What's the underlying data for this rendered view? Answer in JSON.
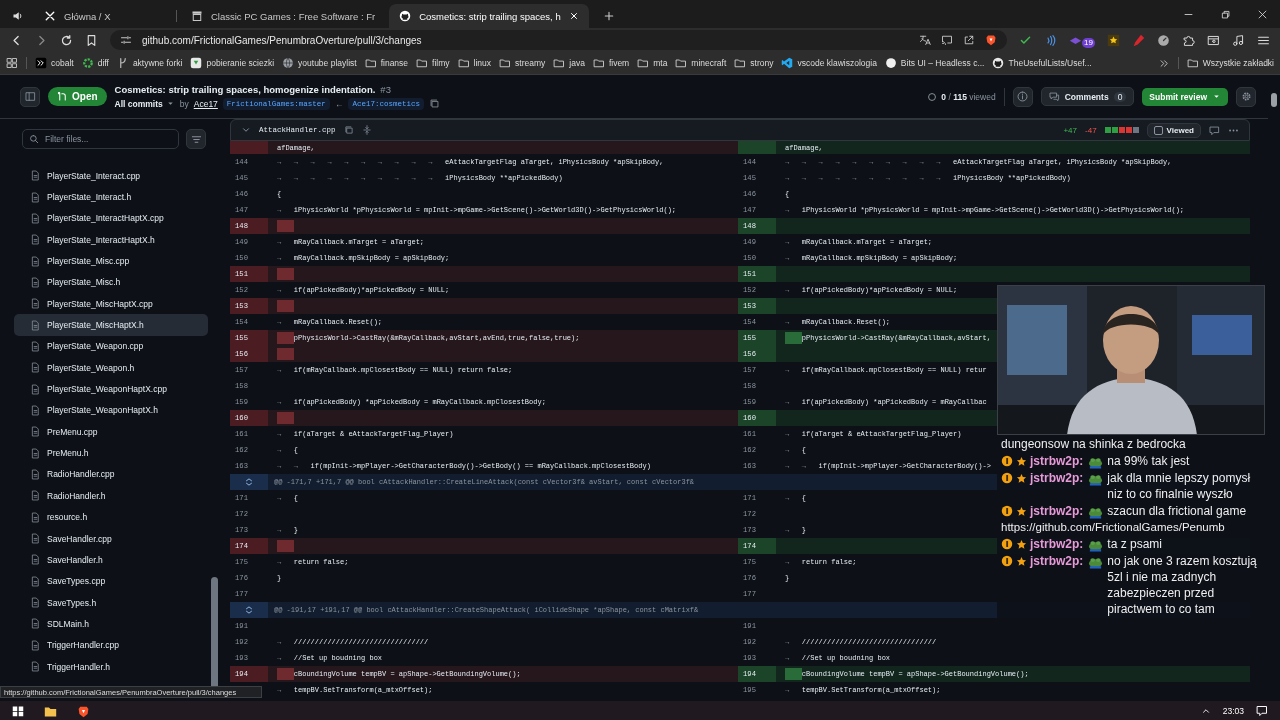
{
  "browser": {
    "tabs": [
      {
        "label": "Główna / X",
        "selected": false
      },
      {
        "label": "Classic PC Games : Free Software : Fr",
        "selected": false
      },
      {
        "label": "Cosmetics: strip trailing spaces, h",
        "selected": true
      }
    ],
    "url": "github.com/FrictionalGames/PenumbraOverture/pull/3/changes",
    "extension_badge": "19",
    "bookmarks": [
      {
        "label": "cobalt",
        "kind": "site"
      },
      {
        "label": "diff",
        "kind": "site"
      },
      {
        "label": "aktywne forki",
        "kind": "site"
      },
      {
        "label": "pobieranie sciezki",
        "kind": "site"
      },
      {
        "label": "youtube playlist",
        "kind": "site"
      },
      {
        "label": "finanse",
        "kind": "folder"
      },
      {
        "label": "filmy",
        "kind": "folder"
      },
      {
        "label": "linux",
        "kind": "folder"
      },
      {
        "label": "streamy",
        "kind": "folder"
      },
      {
        "label": "java",
        "kind": "folder"
      },
      {
        "label": "fivem",
        "kind": "folder"
      },
      {
        "label": "mta",
        "kind": "folder"
      },
      {
        "label": "minecraft",
        "kind": "folder"
      },
      {
        "label": "strony",
        "kind": "folder"
      },
      {
        "label": "vscode klawiszologia",
        "kind": "site"
      },
      {
        "label": "Bits UI – Headless c...",
        "kind": "site"
      },
      {
        "label": "TheUsefulLists/Usef...",
        "kind": "site"
      }
    ],
    "all_bookmarks": "Wszystkie zakładki",
    "status_url": "https://github.com/FrictionalGames/PenumbraOverture/pull/3/changes"
  },
  "pr": {
    "state": "Open",
    "title": "Cosmetics: strip trailing spaces, homogenize indentation.",
    "number": "#3",
    "commits_filter": "All commits",
    "by": "by",
    "author": "Ace17",
    "base": "FrictionalGames:master",
    "arrow": "←",
    "head": "Ace17:cosmetics",
    "viewed": "**0** / **115** viewed",
    "comments": "Comments",
    "comments_count": "0",
    "submit": "Submit review"
  },
  "sidebar": {
    "filter_placeholder": "Filter files...",
    "files": [
      {
        "name": "PlayerState_Interact.cpp",
        "highlighted": false
      },
      {
        "name": "PlayerState_Interact.h",
        "highlighted": false
      },
      {
        "name": "PlayerState_InteractHaptX.cpp",
        "highlighted": false
      },
      {
        "name": "PlayerState_InteractHaptX.h",
        "highlighted": false
      },
      {
        "name": "PlayerState_Misc.cpp",
        "highlighted": false
      },
      {
        "name": "PlayerState_Misc.h",
        "highlighted": false
      },
      {
        "name": "PlayerState_MiscHaptX.cpp",
        "highlighted": false
      },
      {
        "name": "PlayerState_MiscHaptX.h",
        "highlighted": true
      },
      {
        "name": "PlayerState_Weapon.cpp",
        "highlighted": false
      },
      {
        "name": "PlayerState_Weapon.h",
        "highlighted": false
      },
      {
        "name": "PlayerState_WeaponHaptX.cpp",
        "highlighted": false
      },
      {
        "name": "PlayerState_WeaponHaptX.h",
        "highlighted": false
      },
      {
        "name": "PreMenu.cpp",
        "highlighted": false
      },
      {
        "name": "PreMenu.h",
        "highlighted": false
      },
      {
        "name": "RadioHandler.cpp",
        "highlighted": false
      },
      {
        "name": "RadioHandler.h",
        "highlighted": false
      },
      {
        "name": "resource.h",
        "highlighted": false
      },
      {
        "name": "SaveHandler.cpp",
        "highlighted": false
      },
      {
        "name": "SaveHandler.h",
        "highlighted": false
      },
      {
        "name": "SaveTypes.cpp",
        "highlighted": false
      },
      {
        "name": "SaveTypes.h",
        "highlighted": false
      },
      {
        "name": "SDLMain.h",
        "highlighted": false
      },
      {
        "name": "TriggerHandler.cpp",
        "highlighted": false
      },
      {
        "name": "TriggerHandler.h",
        "highlighted": false
      }
    ]
  },
  "file": {
    "name": "AttackHandler.cpp",
    "additions": "+47",
    "deletions": "-47",
    "diffstat": [
      {
        "color": "#2ea043"
      },
      {
        "color": "#2ea043"
      },
      {
        "color": "#da3633"
      },
      {
        "color": "#da3633"
      },
      {
        "color": "#6e7681"
      }
    ],
    "viewed": false,
    "viewed_label": "Viewed",
    "rows": [
      {
        "kind": "cut",
        "left_code": "afDamage,",
        "right_code": "afDamage,"
      },
      {
        "kind": "context",
        "left_num": "144",
        "right_num": "144",
        "indent": "→→→→→→→→→→",
        "left_code": "eAttackTargetFlag aTarget, iPhysicsBody *apSkipBody,",
        "right_code": "eAttackTargetFlag aTarget, iPhysicsBody *apSkipBody,"
      },
      {
        "kind": "context",
        "left_num": "145",
        "right_num": "145",
        "indent": "→→→→→→→→→→",
        "left_code": "iPhysicsBody **apPickedBody)",
        "right_code": "iPhysicsBody **apPickedBody)"
      },
      {
        "kind": "context",
        "left_num": "146",
        "right_num": "146",
        "left_code": "{",
        "right_code": "{"
      },
      {
        "kind": "context",
        "left_num": "147",
        "right_num": "147",
        "indent": "→",
        "left_code": "iPhysicsWorld *pPhysicsWorld = mpInit->mpGame->GetScene()->GetWorld3D()->GetPhysicsWorld();",
        "right_code": "iPhysicsWorld *pPhysicsWorld = mpInit->mpGame->GetScene()->GetWorld3D()->GetPhysicsWorld();"
      },
      {
        "kind": "change",
        "left_num": "148",
        "right_num": "148"
      },
      {
        "kind": "context",
        "left_num": "149",
        "right_num": "149",
        "indent": "→",
        "left_code": "mRayCallback.mTarget = aTarget;",
        "right_code": "mRayCallback.mTarget = aTarget;"
      },
      {
        "kind": "context",
        "left_num": "150",
        "right_num": "150",
        "indent": "→",
        "left_code": "mRayCallback.mpSkipBody = apSkipBody;",
        "right_code": "mRayCallback.mpSkipBody = apSkipBody;"
      },
      {
        "kind": "change",
        "left_num": "151",
        "right_num": "151"
      },
      {
        "kind": "context",
        "left_num": "152",
        "right_num": "152",
        "indent": "→",
        "left_code": "if(apPickedBody)*apPickedBody = NULL;",
        "right_code": "if(apPickedBody)*apPickedBody = NULL;"
      },
      {
        "kind": "change",
        "left_num": "153",
        "right_num": "153"
      },
      {
        "kind": "context",
        "left_num": "154",
        "right_num": "154",
        "indent": "→",
        "left_code": "mRayCallback.Reset();",
        "right_code": "mRayCallback.Reset();"
      },
      {
        "kind": "change",
        "left_num": "155",
        "right_num": "155",
        "left_code": "pPhysicsWorld->CastRay(&mRayCallback,avStart,avEnd,true,false,true);",
        "right_code": "pPhysicsWorld->CastRay(&mRayCallback,avStart,"
      },
      {
        "kind": "change",
        "left_num": "156",
        "right_num": "156"
      },
      {
        "kind": "context",
        "left_num": "157",
        "right_num": "157",
        "indent": "→",
        "left_code": "if(mRayCallback.mpClosestBody == NULL) return false;",
        "right_code": "if(mRayCallback.mpClosestBody == NULL) retur"
      },
      {
        "kind": "context",
        "left_num": "158",
        "right_num": "158"
      },
      {
        "kind": "context",
        "left_num": "159",
        "right_num": "159",
        "indent": "→",
        "left_code": "if(apPickedBody) *apPickedBody = mRayCallback.mpClosestBody;",
        "right_code": "if(apPickedBody) *apPickedBody = mRayCallbac"
      },
      {
        "kind": "change",
        "left_num": "160",
        "right_num": "160"
      },
      {
        "kind": "context",
        "left_num": "161",
        "right_num": "161",
        "indent": "→",
        "left_code": "if(aTarget & eAttackTargetFlag_Player)",
        "right_code": "if(aTarget & eAttackTargetFlag_Player)"
      },
      {
        "kind": "context",
        "left_num": "162",
        "right_num": "162",
        "indent": "→",
        "left_code": "{",
        "right_code": "{"
      },
      {
        "kind": "context",
        "left_num": "163",
        "right_num": "163",
        "indent": "→→",
        "left_code": "if(mpInit->mpPlayer->GetCharacterBody()->GetBody() == mRayCallback.mpClosestBody)",
        "right_code": "if(mpInit->mpPlayer->GetCharacterBody()->"
      },
      {
        "kind": "hunk",
        "text": "@@ -171,7 +171,7 @@ bool cAttackHandler::CreateLineAttack(const cVector3f& avStart, const cVector3f&"
      },
      {
        "kind": "context",
        "left_num": "171",
        "right_num": "171",
        "indent": "→",
        "left_code": "{",
        "right_code": "{"
      },
      {
        "kind": "context",
        "left_num": "172",
        "right_num": "172"
      },
      {
        "kind": "context",
        "left_num": "173",
        "right_num": "173",
        "indent": "→",
        "left_code": "}",
        "right_code": "}"
      },
      {
        "kind": "change",
        "left_num": "174",
        "right_num": "174"
      },
      {
        "kind": "context",
        "left_num": "175",
        "right_num": "175",
        "indent": "→",
        "left_code": "return false;",
        "right_code": "return false;"
      },
      {
        "kind": "context",
        "left_num": "176",
        "right_num": "176",
        "left_code": "}",
        "right_code": "}"
      },
      {
        "kind": "context",
        "left_num": "177",
        "right_num": "177"
      },
      {
        "kind": "hunk",
        "text": "@@ -191,17 +191,17 @@ bool cAttackHandler::CreateShapeAttack( iCollideShape *apShape, const cMatrixf&"
      },
      {
        "kind": "context",
        "left_num": "191",
        "right_num": "191"
      },
      {
        "kind": "context",
        "left_num": "192",
        "right_num": "192",
        "indent": "→",
        "left_code": "////////////////////////////////",
        "right_code": "////////////////////////////////"
      },
      {
        "kind": "context",
        "left_num": "193",
        "right_num": "193",
        "indent": "→",
        "left_code": "//Set up boudning box",
        "right_code": "//Set up boudning box"
      },
      {
        "kind": "change",
        "left_num": "194",
        "right_num": "194",
        "left_code": "cBoundingVolume tempBV = apShape->GetBoundingVolume();",
        "right_code": "cBoundingVolume tempBV = apShape->GetBoundingVolume();"
      },
      {
        "kind": "context",
        "right_num": "195",
        "indent": "→",
        "left_code": "tempBV.SetTransform(a_mtxOffset);",
        "right_code": "tempBV.SetTransform(a_mtxOffset);"
      }
    ]
  },
  "chat": {
    "partial_line": "dungeonsow na shinka z bedrocka",
    "messages": [
      {
        "user": "jstrbw2p:",
        "text": "na 99% tak jest"
      },
      {
        "user": "jstrbw2p:",
        "text": "jak dla mnie lepszy pomysł niz to co finalnie wyszło"
      },
      {
        "user": "jstrbw2p:",
        "text": "szacun dla frictional game",
        "link": "https://github.com/FrictionalGames/Penumb"
      },
      {
        "user": "jstrbw2p:",
        "text": "ta z psami"
      },
      {
        "user": "jstrbw2p:",
        "text": "no jak one 3 razem kosztują 5zl i nie ma zadnych zabezpieczen przed piractwem to co tam"
      }
    ]
  },
  "taskbar": {
    "time": "23:03"
  }
}
